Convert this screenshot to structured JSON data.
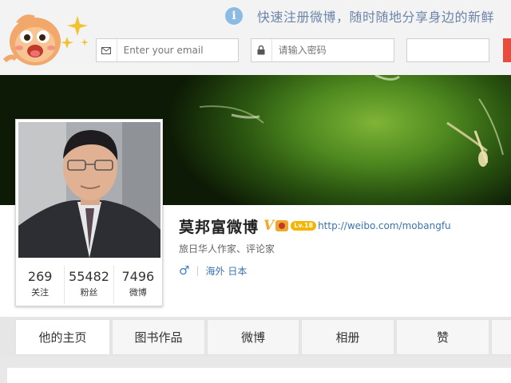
{
  "topbar": {
    "notice_text": "快速注册微博，随时随地分享身边的新鲜",
    "email_placeholder": "Enter your email",
    "password_placeholder": "请输入密码",
    "icons": {
      "info": "info-icon",
      "email": "envelope-icon",
      "password": "lock-icon"
    },
    "accent_color": "#e84c3d"
  },
  "profile": {
    "name": "莫邦富微博",
    "verified_badge": "V",
    "level_badge": "Lv.18",
    "homepage": "http://weibo.com/mobangfu",
    "bio": "旅日华人作家、评论家",
    "gender_symbol": "♂",
    "separator": "|",
    "location": "海外 日本",
    "stats": [
      {
        "value": "269",
        "label": "关注"
      },
      {
        "value": "55482",
        "label": "粉丝"
      },
      {
        "value": "7496",
        "label": "微博"
      }
    ]
  },
  "tabs": [
    {
      "label": "他的主页"
    },
    {
      "label": "图书作品"
    },
    {
      "label": "微博"
    },
    {
      "label": "相册"
    },
    {
      "label": "赞"
    },
    {
      "label": ""
    }
  ],
  "colors": {
    "link": "#3a74b0",
    "notice": "#6b86a8",
    "badge": "#f5a623"
  }
}
